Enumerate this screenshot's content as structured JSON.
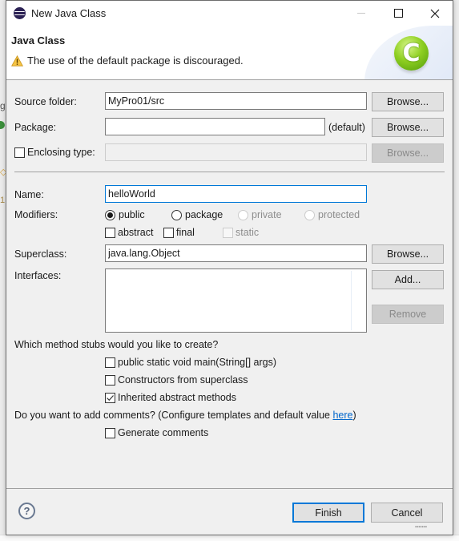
{
  "window": {
    "title": "New Java Class",
    "app_icon": "eclipse-icon",
    "controls": {
      "minimize": "minimize",
      "maximize": "maximize",
      "close": "close"
    }
  },
  "banner": {
    "heading": "Java Class",
    "warning_icon": "warning-icon",
    "message": "The use of the default package is discouraged.",
    "wizard_icon_glyph": "C"
  },
  "form": {
    "source_folder": {
      "label": "Source folder:",
      "value": "MyPro01/src",
      "browse": "Browse..."
    },
    "package": {
      "label": "Package:",
      "value": "",
      "suffix": "(default)",
      "browse": "Browse..."
    },
    "enclosing_type": {
      "label": "Enclosing type:",
      "checked": false,
      "value": "",
      "browse": "Browse...",
      "enabled": false
    },
    "name": {
      "label": "Name:",
      "value": "helloWorld"
    },
    "modifiers": {
      "label": "Modifiers:",
      "access": [
        {
          "label": "public",
          "selected": true,
          "enabled": true
        },
        {
          "label": "package",
          "selected": false,
          "enabled": true
        },
        {
          "label": "private",
          "selected": false,
          "enabled": false
        },
        {
          "label": "protected",
          "selected": false,
          "enabled": false
        }
      ],
      "flags": [
        {
          "label": "abstract",
          "checked": false,
          "enabled": true
        },
        {
          "label": "final",
          "checked": false,
          "enabled": true
        },
        {
          "label": "static",
          "checked": false,
          "enabled": false
        }
      ]
    },
    "superclass": {
      "label": "Superclass:",
      "value": "java.lang.Object",
      "browse": "Browse..."
    },
    "interfaces": {
      "label": "Interfaces:",
      "items": [],
      "add": "Add...",
      "remove": "Remove"
    },
    "stubs": {
      "question": "Which method stubs would you like to create?",
      "options": [
        {
          "label": "public static void main(String[] args)",
          "checked": false
        },
        {
          "label": "Constructors from superclass",
          "checked": false
        },
        {
          "label": "Inherited abstract methods",
          "checked": true
        }
      ]
    },
    "comments": {
      "question_prefix": "Do you want to add comments? (Configure templates and default value ",
      "link": "here",
      "question_suffix": ")",
      "option": {
        "label": "Generate comments",
        "checked": false
      }
    }
  },
  "footer": {
    "help_glyph": "?",
    "finish": "Finish",
    "cancel": "Cancel"
  },
  "colors": {
    "accent": "#0078d7",
    "link": "#0066cc",
    "wizard_icon": "#8fcf22",
    "warning": "#f0b429"
  }
}
